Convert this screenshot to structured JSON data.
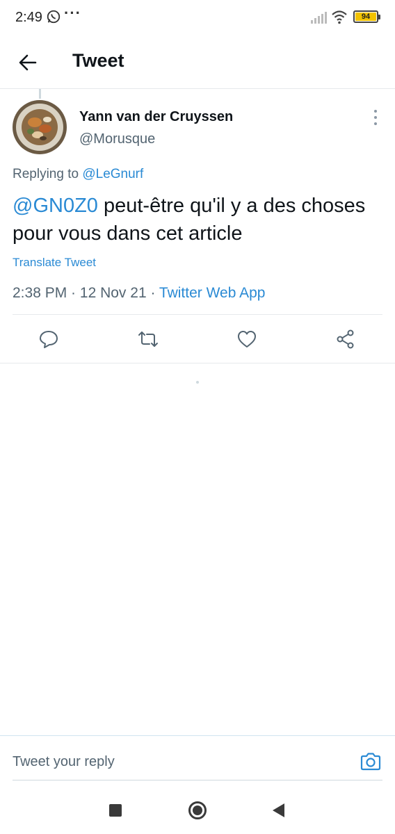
{
  "status_bar": {
    "time": "2:49",
    "overflow": "···",
    "battery": "94",
    "icons": [
      "whatsapp-icon",
      "signal-icon",
      "wifi-icon",
      "battery-icon"
    ],
    "battery_color": "#f2c200"
  },
  "header": {
    "back_icon": "arrow-left-icon",
    "title": "Tweet"
  },
  "tweet": {
    "author_name": "Yann van der Cruyssen",
    "author_handle": "@Morusque",
    "replying_prefix": "Replying to",
    "replying_to": "@LeGnurf",
    "mention": "@GN0Z0",
    "text": " peut-être qu'il y a des choses pour vous dans cet article",
    "translate_label": "Translate Tweet",
    "time": "2:38 PM",
    "separator": " · ",
    "date": "12 Nov 21",
    "source": "Twitter Web App",
    "actions": [
      {
        "name": "reply-icon"
      },
      {
        "name": "retweet-icon"
      },
      {
        "name": "like-icon"
      },
      {
        "name": "share-icon"
      }
    ]
  },
  "reply_bar": {
    "placeholder": "Tweet your reply",
    "camera_icon": "camera-icon"
  },
  "nav_bar": {
    "buttons": [
      "recents-button",
      "home-button",
      "back-button"
    ]
  },
  "colors": {
    "accent": "#2a8ad4",
    "text": "#0f1419",
    "secondary": "#536471"
  }
}
